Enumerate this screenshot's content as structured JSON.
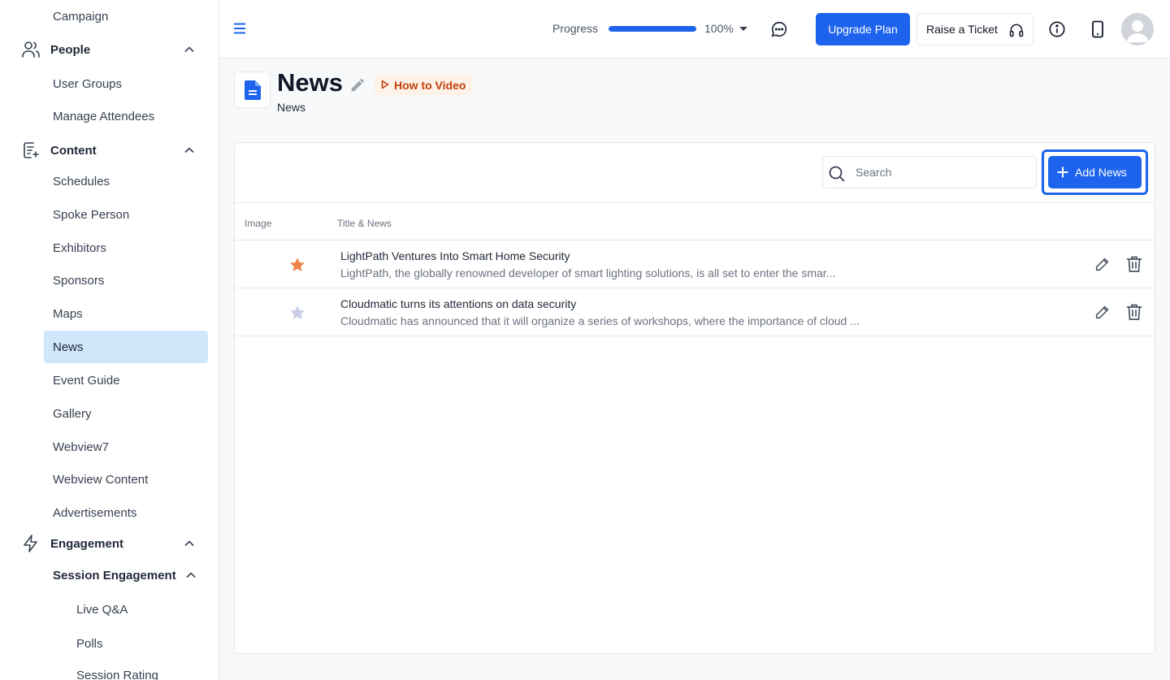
{
  "sidebar": {
    "items": [
      {
        "label": "Campaign"
      },
      {
        "label": "People"
      },
      {
        "label": "User Groups"
      },
      {
        "label": "Manage Attendees"
      },
      {
        "label": "Content"
      },
      {
        "label": "Schedules"
      },
      {
        "label": "Spoke Person"
      },
      {
        "label": "Exhibitors"
      },
      {
        "label": "Sponsors"
      },
      {
        "label": "Maps"
      },
      {
        "label": "News"
      },
      {
        "label": "Event Guide"
      },
      {
        "label": "Gallery"
      },
      {
        "label": "Webview7"
      },
      {
        "label": "Webview Content"
      },
      {
        "label": "Advertisements"
      },
      {
        "label": "Engagement"
      },
      {
        "label": "Session Engagement"
      },
      {
        "label": "Live Q&A"
      },
      {
        "label": "Polls"
      },
      {
        "label": "Session Rating"
      }
    ],
    "active": "News",
    "icons": {
      "people": "people-icon",
      "content": "content-icon",
      "engagement": "lightning-icon"
    }
  },
  "topbar": {
    "progress_label": "Progress",
    "progress_value": "100%",
    "progress_fraction": 1.0,
    "upgrade_label": "Upgrade Plan",
    "ticket_label": "Raise a Ticket"
  },
  "page": {
    "title": "News",
    "subtitle": "News",
    "howto_label": "How to Video"
  },
  "toolbar": {
    "search_placeholder": "Search",
    "add_label": "Add News"
  },
  "table": {
    "headers": {
      "image": "Image",
      "title": "Title & News"
    },
    "rows": [
      {
        "title": "LightPath Ventures Into Smart Home Security",
        "desc": "LightPath, the globally renowned developer of smart lighting solutions, is all set to enter the smar...",
        "star": "#f0834d"
      },
      {
        "title": "Cloudmatic turns its attentions on data security",
        "desc": "Cloudmatic has announced that it will organize a series of workshops, where the importance of cloud ...",
        "star": "#c9cde8"
      }
    ]
  },
  "colors": {
    "accent": "#1d63ed",
    "active_bg": "#cfe6fb",
    "howto_text": "#c2410c"
  }
}
